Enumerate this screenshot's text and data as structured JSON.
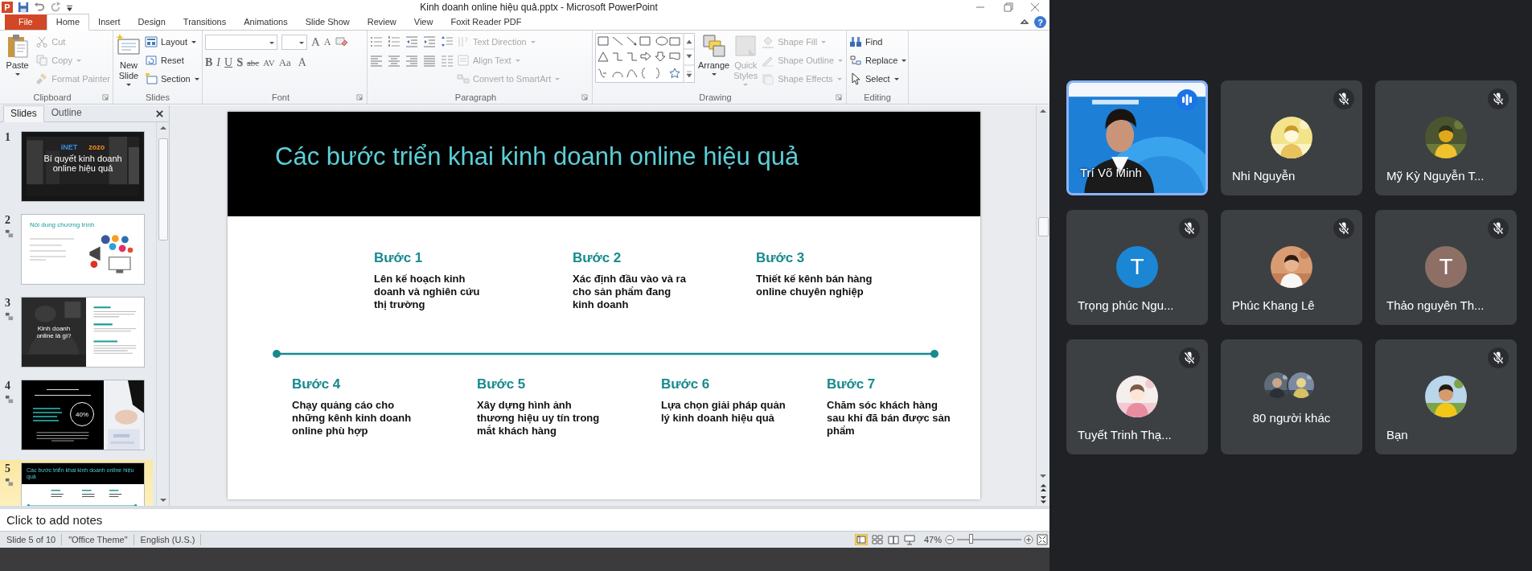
{
  "window": {
    "app_logo": "P",
    "title": "Kinh doanh online hiệu quả.pptx - Microsoft PowerPoint"
  },
  "ribbon_tabs": [
    {
      "label": "File",
      "kind": "file",
      "selected": false
    },
    {
      "label": "Home",
      "kind": "tab",
      "selected": true
    },
    {
      "label": "Insert",
      "kind": "tab",
      "selected": false
    },
    {
      "label": "Design",
      "kind": "tab",
      "selected": false
    },
    {
      "label": "Transitions",
      "kind": "tab",
      "selected": false
    },
    {
      "label": "Animations",
      "kind": "tab",
      "selected": false
    },
    {
      "label": "Slide Show",
      "kind": "tab",
      "selected": false
    },
    {
      "label": "Review",
      "kind": "tab",
      "selected": false
    },
    {
      "label": "View",
      "kind": "tab",
      "selected": false
    },
    {
      "label": "Foxit Reader PDF",
      "kind": "tab",
      "selected": false
    }
  ],
  "help_button": "?",
  "ribbon_groups": [
    {
      "label": "Clipboard",
      "kind": "clipboard",
      "launcher": true,
      "large": [
        {
          "label": "Paste",
          "dropdown": true,
          "disabled": false
        }
      ],
      "small": [
        {
          "label": "Cut",
          "dropdown": false,
          "disabled": true
        },
        {
          "label": "Copy",
          "dropdown": true,
          "disabled": true
        },
        {
          "label": "Format Painter",
          "dropdown": false,
          "disabled": true
        }
      ]
    },
    {
      "label": "Slides",
      "kind": "slides",
      "large": [
        {
          "label": "New Slide",
          "dropdown": true,
          "disabled": false
        }
      ],
      "small": [
        {
          "label": "Layout",
          "dropdown": true,
          "disabled": false
        },
        {
          "label": "Reset",
          "dropdown": false,
          "disabled": false
        },
        {
          "label": "Section",
          "dropdown": true,
          "disabled": false
        }
      ]
    },
    {
      "label": "Font",
      "kind": "font",
      "launcher": true,
      "size_buttons": [
        "A",
        "A"
      ],
      "format_buttons": [
        "B",
        "I",
        "U",
        "S",
        "abc",
        "AV",
        "Aa",
        "A"
      ]
    },
    {
      "label": "Paragraph",
      "kind": "paragraph",
      "launcher": true,
      "small": [
        {
          "label": "Text Direction",
          "dropdown": true,
          "disabled": true
        },
        {
          "label": "Align Text",
          "dropdown": true,
          "disabled": true
        },
        {
          "label": "Convert to SmartArt",
          "dropdown": true,
          "disabled": true
        }
      ]
    },
    {
      "label": "Drawing",
      "kind": "drawing",
      "launcher": true,
      "large": [
        {
          "label": "Arrange",
          "dropdown": true,
          "disabled": false
        },
        {
          "label": "Quick Styles",
          "dropdown": true,
          "disabled": true
        }
      ],
      "small": [
        {
          "label": "Shape Fill",
          "dropdown": true,
          "disabled": true
        },
        {
          "label": "Shape Outline",
          "dropdown": true,
          "disabled": true
        },
        {
          "label": "Shape Effects",
          "dropdown": true,
          "disabled": true
        }
      ]
    },
    {
      "label": "Editing",
      "kind": "editing",
      "small": [
        {
          "label": "Find",
          "dropdown": false,
          "disabled": false
        },
        {
          "label": "Replace",
          "dropdown": true,
          "disabled": false
        },
        {
          "label": "Select",
          "dropdown": true,
          "disabled": false
        }
      ]
    }
  ],
  "slides_panel": {
    "tabs": [
      {
        "label": "Slides",
        "selected": true
      },
      {
        "label": "Outline",
        "selected": false
      }
    ],
    "thumbnails": [
      {
        "number": "1",
        "kind": "title",
        "selected": false,
        "transition": false,
        "texts": [
          "iNET",
          "zozo",
          "Bí quyết kinh doanh online hiệu quả"
        ]
      },
      {
        "number": "2",
        "kind": "agenda",
        "selected": false,
        "transition": true,
        "texts": [
          "Nội dung chương trình"
        ]
      },
      {
        "number": "3",
        "kind": "split",
        "selected": false,
        "transition": true,
        "texts": [
          "Kinh doanh online là gì?"
        ]
      },
      {
        "number": "4",
        "kind": "stat",
        "selected": false,
        "transition": true,
        "texts": [
          "40%"
        ]
      },
      {
        "number": "5",
        "kind": "steps",
        "selected": true,
        "transition": true,
        "texts": [
          "Các bước triển khai kinh doanh online hiệu quả"
        ]
      }
    ]
  },
  "slide": {
    "title": "Các bước triển khai kinh doanh online hiệu quả",
    "top_steps": [
      {
        "heading": "Bước 1",
        "text": "Lên kế hoạch kinh doanh và nghiên cứu thị trường"
      },
      {
        "heading": "Bước 2",
        "text": "Xác định đầu vào và ra cho sản phẩm đang kinh doanh"
      },
      {
        "heading": "Bước 3",
        "text": "Thiết kế kênh bán hàng online chuyên nghiệp"
      }
    ],
    "bottom_steps": [
      {
        "heading": "Bước 4",
        "text": "Chạy quảng cáo cho những kênh kinh doanh online phù hợp"
      },
      {
        "heading": "Bước 5",
        "text": "Xây dựng hình ảnh thương hiệu uy tín trong mắt khách hàng"
      },
      {
        "heading": "Bước 6",
        "text": "Lựa chọn giải pháp quản lý kinh doanh hiệu quả"
      },
      {
        "heading": "Bước 7",
        "text": "Chăm sóc khách hàng sau khi đã bán được sản phẩm"
      }
    ]
  },
  "notes": {
    "placeholder": "Click to add notes"
  },
  "status_bar": {
    "slide": "Slide 5 of 10",
    "theme": "\"Office Theme\"",
    "language": "English (U.S.)",
    "views": [
      {
        "selected": true
      },
      {
        "selected": false
      },
      {
        "selected": false
      },
      {
        "selected": false
      }
    ],
    "zoom": "47%",
    "zoom_slider": {
      "level": 0.21
    }
  },
  "meeting": {
    "tiles": [
      {
        "kind": "video",
        "name": "Trí Võ Minh",
        "speaking": true,
        "muted": false
      },
      {
        "kind": "person",
        "name": "Nhi Nguyễn",
        "speaking": false,
        "muted": true
      },
      {
        "kind": "person",
        "name": "Mỹ Kỳ Nguyễn T...",
        "speaking": false,
        "muted": true
      },
      {
        "kind": "person",
        "name": "Trọng phúc Ngu...",
        "speaking": false,
        "muted": true,
        "avatar": {
          "kind": "letter",
          "letter": "T",
          "color": "#1a86d4"
        }
      },
      {
        "kind": "person",
        "name": "Phúc Khang Lê",
        "speaking": false,
        "muted": true
      },
      {
        "kind": "person",
        "name": "Thảo nguyên Th...",
        "speaking": false,
        "muted": true,
        "avatar": {
          "kind": "letter",
          "letter": "T",
          "color": "#8e6f66"
        }
      },
      {
        "kind": "person",
        "name": "Tuyết Trinh Thạ...",
        "speaking": false,
        "muted": true
      },
      {
        "kind": "others",
        "name": "80 người khác",
        "speaking": false,
        "muted": false
      },
      {
        "kind": "person",
        "name": "Bạn",
        "speaking": false,
        "muted": true
      }
    ]
  }
}
